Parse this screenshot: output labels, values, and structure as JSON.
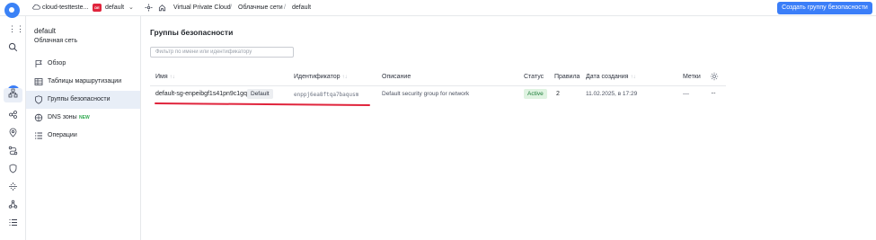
{
  "topbar": {
    "cloud_name": "cloud-testteste...",
    "folder_badge": "DE",
    "folder_name": "default",
    "breadcrumb": [
      "Virtual Private Cloud",
      "Облачные сети",
      "default"
    ],
    "separator": "/",
    "create_button": "Создать группу безопасности",
    "accent_color": "#3b7ef8"
  },
  "rail": {
    "avatar_letter": "W",
    "icons": [
      "logo-icon",
      "apps-grid-icon",
      "search-icon",
      "network-icon",
      "nodes-icon",
      "location-icon",
      "route-icon",
      "shield-icon",
      "balancer-icon",
      "graph-icon",
      "list-icon"
    ]
  },
  "sidenav": {
    "title": "default",
    "subtitle": "Облачная сеть",
    "items": [
      {
        "label": "Обзор",
        "icon": "flag-icon"
      },
      {
        "label": "Таблицы маршрутизации",
        "icon": "route-table-icon"
      },
      {
        "label": "Группы безопасности",
        "icon": "shield-icon",
        "active": true
      },
      {
        "label": "DNS зоны",
        "icon": "dns-icon",
        "badge": "NEW"
      },
      {
        "label": "Операции",
        "icon": "operations-icon"
      }
    ]
  },
  "main": {
    "title": "Группы безопасности",
    "filter_placeholder": "Фильтр по имени или идентификатору",
    "columns": {
      "name": "Имя",
      "id": "Идентификатор",
      "description": "Описание",
      "status": "Статус",
      "rules": "Правила",
      "created": "Дата создания",
      "labels": "Метки"
    },
    "sort_glyph": "↑↓",
    "rows": [
      {
        "name": "default-sg-enpeibgf1s41pn9c1gq3",
        "badge": "Default",
        "id": "enppj6ea8ftqa7baqusm",
        "description": "Default security group for network",
        "status": "Active",
        "rules": "2",
        "created": "11.02.2025, в 17:29",
        "labels": "—",
        "menu": "···"
      }
    ]
  },
  "colors": {
    "active_nav_bg": "#e8eef7",
    "status_active_bg": "#dff3e1",
    "status_active_text": "#1d7d39",
    "annotation_red": "#e0243c"
  }
}
